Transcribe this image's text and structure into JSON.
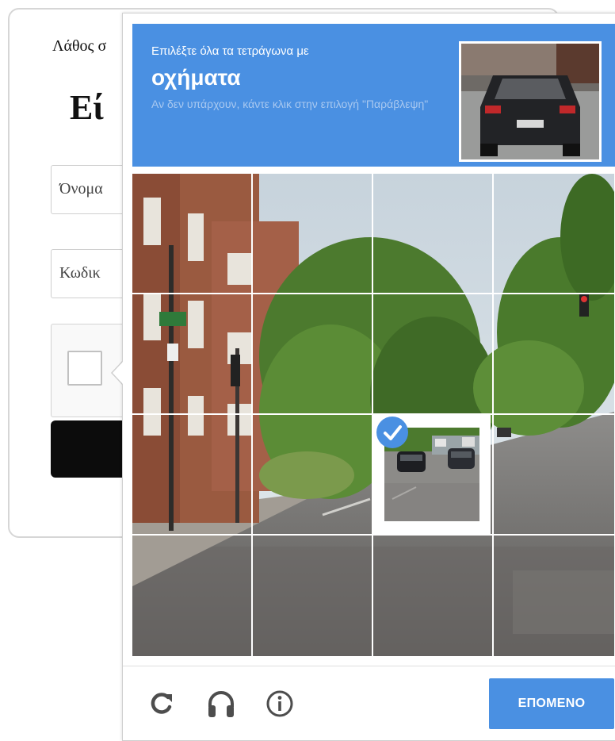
{
  "login": {
    "error_text": "Λάθος σ",
    "title": "Εί",
    "username_placeholder": "Όνομα",
    "password_placeholder": "Κωδικ"
  },
  "challenge": {
    "instruction": "Επιλέξτε όλα τα τετράγωνα με",
    "target": "οχήματα",
    "hint": "Αν δεν υπάρχουν, κάντε κλικ στην επιλογή \"Παράβλεψη\"",
    "grid_size": "4x4",
    "selected_tiles": [
      "row3-col3"
    ],
    "next_label": "ΕΠΟΜΕΝΟ",
    "icons": [
      "reload-icon",
      "audio-icon",
      "info-icon"
    ],
    "colors": {
      "accent": "#4a90e2",
      "hint": "#a8c8f0"
    }
  }
}
